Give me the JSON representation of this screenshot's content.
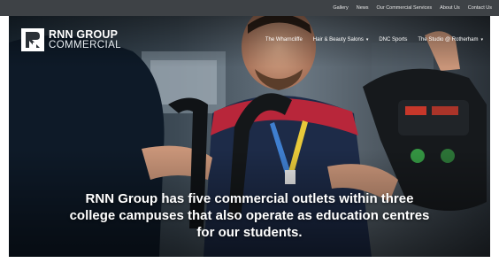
{
  "colors": {
    "top_strip": "#3e4246",
    "text_light": "#ffffff",
    "console_red": "#d83a2a",
    "console_green": "#3fbf4f",
    "lanyard_blue": "#3f7fd0"
  },
  "top_nav": {
    "links": [
      "Gallery",
      "News",
      "Our Commercial Services",
      "About Us",
      "Contact Us"
    ]
  },
  "logo": {
    "line1": "RNN GROUP",
    "line2": "COMMERCIAL",
    "icon": "rnn-monogram-icon"
  },
  "main_nav": {
    "items": [
      {
        "label": "The Wharncliffe",
        "dropdown": false
      },
      {
        "label": "Hair & Beauty Salons",
        "dropdown": true
      },
      {
        "label": "DNC Sports",
        "dropdown": false
      },
      {
        "label": "The Studio @ Rotherham",
        "dropdown": true
      }
    ]
  },
  "hero": {
    "headline": "RNN Group has five commercial outlets within three college campuses that also operate as education centres for our students."
  }
}
